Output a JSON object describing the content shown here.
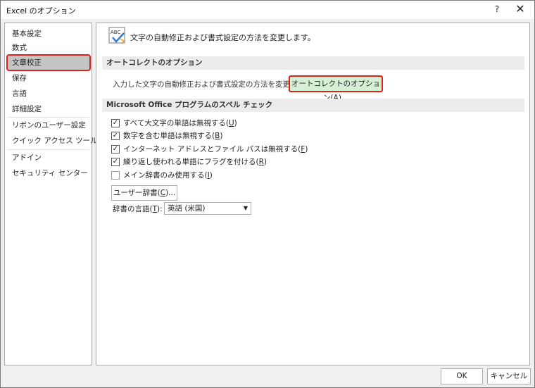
{
  "window": {
    "title": "Excel のオプション",
    "help_glyph": "?",
    "close_glyph": "✕"
  },
  "sidebar": {
    "items": [
      {
        "label": "基本設定"
      },
      {
        "label": "数式"
      },
      {
        "label": "文章校正",
        "selected": true
      },
      {
        "label": "保存"
      },
      {
        "label": "言語"
      },
      {
        "label": "詳細設定"
      },
      {
        "label": "リボンのユーザー設定"
      },
      {
        "label": "クイック アクセス ツール バー"
      },
      {
        "label": "アドイン"
      },
      {
        "label": "セキュリティ センター"
      }
    ]
  },
  "header": {
    "icon": "abc-check-icon",
    "icon_text": "ABC",
    "text": "文字の自動修正および書式設定の方法を変更します。"
  },
  "autocorrect": {
    "section_title": "オートコレクトのオプション",
    "label": "入力した文字の自動修正および書式設定の方法を変更します:",
    "button_label": "オートコレクトのオプション(",
    "button_key": "A",
    "button_suffix": ")..."
  },
  "spelling": {
    "section_title": "Microsoft Office プログラムのスペル チェック",
    "checks": [
      {
        "label": "すべて大文字の単語は無視する(",
        "key": "U",
        "checked": true
      },
      {
        "label": "数字を含む単語は無視する(",
        "key": "B",
        "checked": true
      },
      {
        "label": "インターネット アドレスとファイル パスは無視する(",
        "key": "F",
        "checked": true
      },
      {
        "label": "繰り返し使われる単語にフラグを付ける(",
        "key": "R",
        "checked": true
      },
      {
        "label": "メイン辞書のみ使用する(",
        "key": "I",
        "checked": false
      }
    ],
    "dict_button": "ユーザー辞書(",
    "dict_button_key": "C",
    "dict_button_suffix": ")...",
    "language_label": "辞書の言語(",
    "language_key": "T",
    "language_suffix": "):",
    "language_value": "英語 (米国)"
  },
  "footer": {
    "ok": "OK",
    "cancel": "キャンセル"
  },
  "colors": {
    "highlight": "#e0201a",
    "selected_bg": "#c5c5c5",
    "button_green": "#d6f0d6"
  }
}
